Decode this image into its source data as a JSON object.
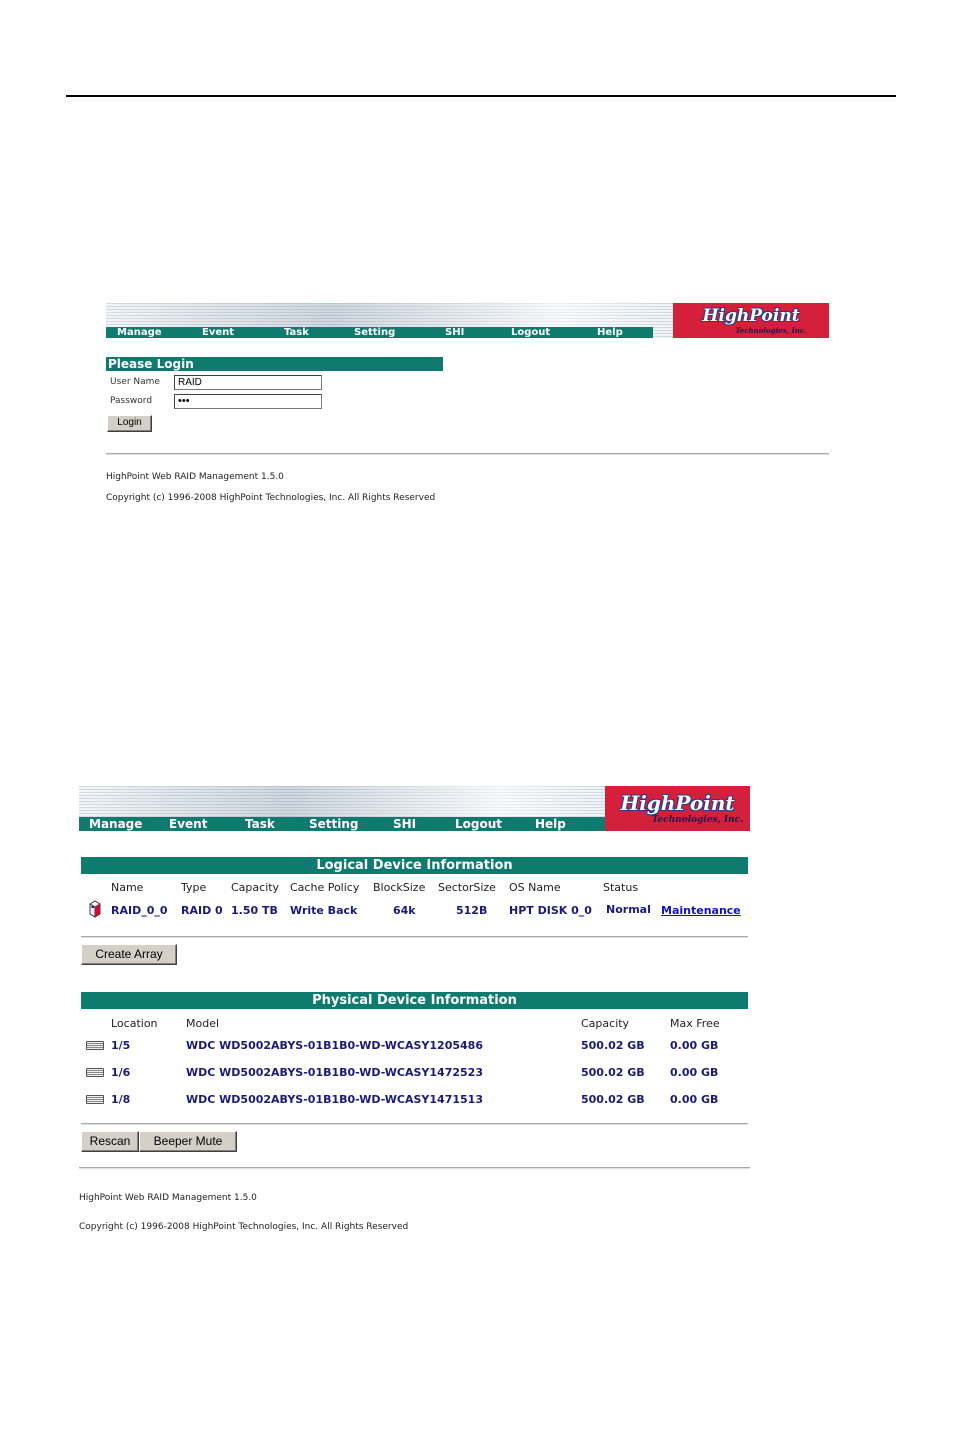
{
  "nav": {
    "items": [
      "Manage",
      "Event",
      "Task",
      "Setting",
      "SHI",
      "Logout",
      "Help"
    ],
    "logo_brand": "HighPoint",
    "logo_tagline": "Technologies, Inc."
  },
  "login": {
    "title": "Please Login",
    "username_label": "User Name",
    "username_value": "RAID",
    "password_label": "Password",
    "password_mask": "•••",
    "login_button": "Login"
  },
  "footer": {
    "version": "HighPoint Web RAID Management 1.5.0",
    "copyright": "Copyright (c) 1996-2008 HighPoint Technologies, Inc. All Rights Reserved"
  },
  "logical": {
    "title": "Logical Device Information",
    "columns": [
      "Name",
      "Type",
      "Capacity",
      "Cache Policy",
      "BlockSize",
      "SectorSize",
      "OS Name",
      "Status"
    ],
    "row": {
      "name": "RAID_0_0",
      "type": "RAID 0",
      "capacity": "1.50 TB",
      "cache_policy": "Write Back",
      "block_size": "64k",
      "sector_size": "512B",
      "os_name": "HPT DISK 0_0",
      "status": "Normal",
      "action": "Maintenance"
    },
    "create_button": "Create Array"
  },
  "physical": {
    "title": "Physical Device Information",
    "columns": [
      "Location",
      "Model",
      "Capacity",
      "Max Free"
    ],
    "rows": [
      {
        "location": "1/5",
        "model": "WDC WD5002ABYS-01B1B0-WD-WCASY1205486",
        "capacity": "500.02 GB",
        "max_free": "0.00 GB"
      },
      {
        "location": "1/6",
        "model": "WDC WD5002ABYS-01B1B0-WD-WCASY1472523",
        "capacity": "500.02 GB",
        "max_free": "0.00 GB"
      },
      {
        "location": "1/8",
        "model": "WDC WD5002ABYS-01B1B0-WD-WCASY1471513",
        "capacity": "500.02 GB",
        "max_free": "0.00 GB"
      }
    ],
    "rescan_button": "Rescan",
    "mute_button": "Beeper Mute"
  }
}
